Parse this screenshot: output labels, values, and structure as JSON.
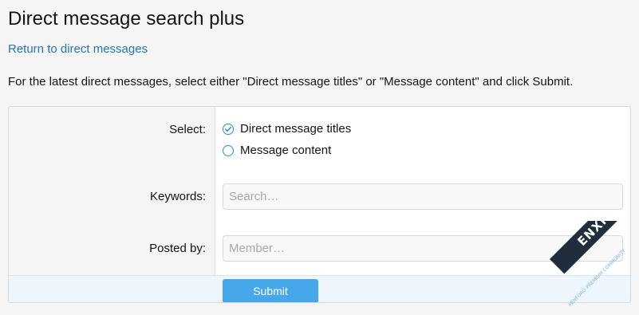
{
  "page": {
    "title": "Direct message search plus",
    "return_link": "Return to direct messages",
    "intro": "For the latest direct messages, select either \"Direct message titles\" or \"Message content\" and click Submit."
  },
  "form": {
    "select_label": "Select:",
    "options": [
      {
        "label": "Direct message titles",
        "selected": true
      },
      {
        "label": "Message content",
        "selected": false
      }
    ],
    "keywords_label": "Keywords:",
    "keywords_value": "",
    "keywords_placeholder": "Search…",
    "posted_by_label": "Posted by:",
    "posted_by_value": "",
    "posted_by_placeholder": "Member…",
    "submit_label": "Submit"
  },
  "watermark": {
    "text": "ENXF.NET",
    "subtext": "XENFORO PREMIUM COMMUNITY"
  },
  "colors": {
    "link": "#2577b1",
    "radio_accent": "#2d8bd0",
    "submit_bg": "#47a7eb",
    "submit_row_bg": "#edf6fd",
    "label_column_bg": "#f5f5f5"
  },
  "icons": {
    "selected_radio": "radio-checked-icon",
    "unselected_radio": "radio-unchecked-icon"
  }
}
